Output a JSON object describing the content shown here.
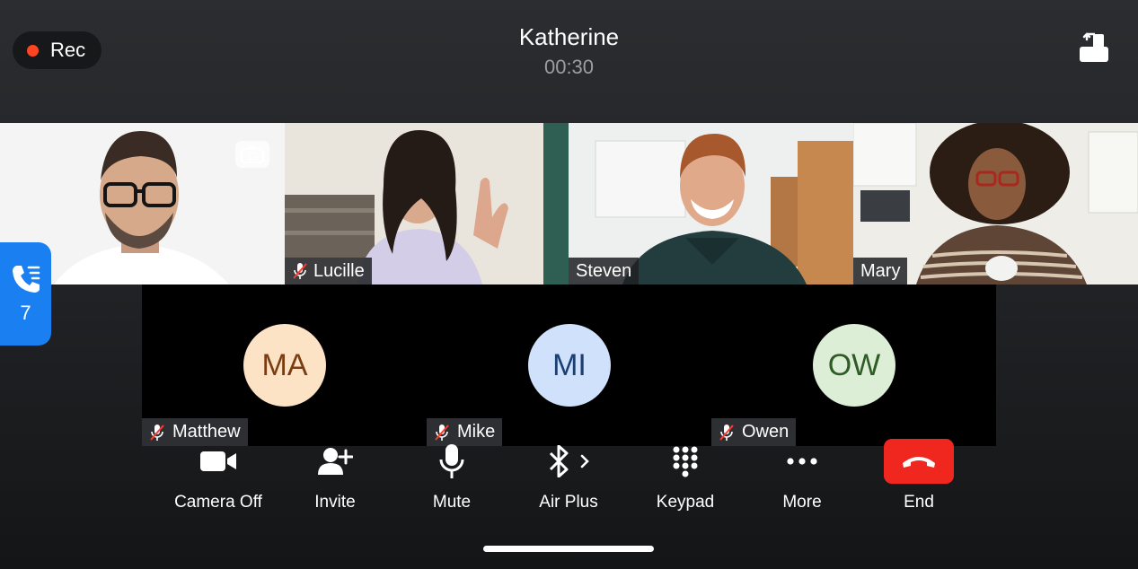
{
  "header": {
    "rec_label": "Rec",
    "caller_name": "Katherine",
    "timer": "00:30"
  },
  "queue_tab": {
    "count": "7",
    "icon": "phone-queue-icon"
  },
  "video_participants": [
    {
      "name": "",
      "muted": false,
      "self_view": true
    },
    {
      "name": "Lucille",
      "muted": true
    },
    {
      "name": "Steven",
      "muted": false
    },
    {
      "name": "Mary",
      "muted": false
    }
  ],
  "audio_participants": [
    {
      "initials": "MA",
      "name": "Matthew",
      "muted": true,
      "bg": "#fde3c6",
      "fg": "#7a3d12"
    },
    {
      "initials": "MI",
      "name": "Mike",
      "muted": true,
      "bg": "#cfe1fb",
      "fg": "#1c3f73"
    },
    {
      "initials": "OW",
      "name": "Owen",
      "muted": true,
      "bg": "#dcefd6",
      "fg": "#2f5c26"
    }
  ],
  "controls": {
    "camera_off": "Camera Off",
    "invite": "Invite",
    "mute": "Mute",
    "air_plus": "Air Plus",
    "keypad": "Keypad",
    "more": "More",
    "end": "End"
  },
  "colors": {
    "rec_dot": "#ff4422",
    "end_button": "#f0271f",
    "queue_tab": "#1a7ff0"
  }
}
